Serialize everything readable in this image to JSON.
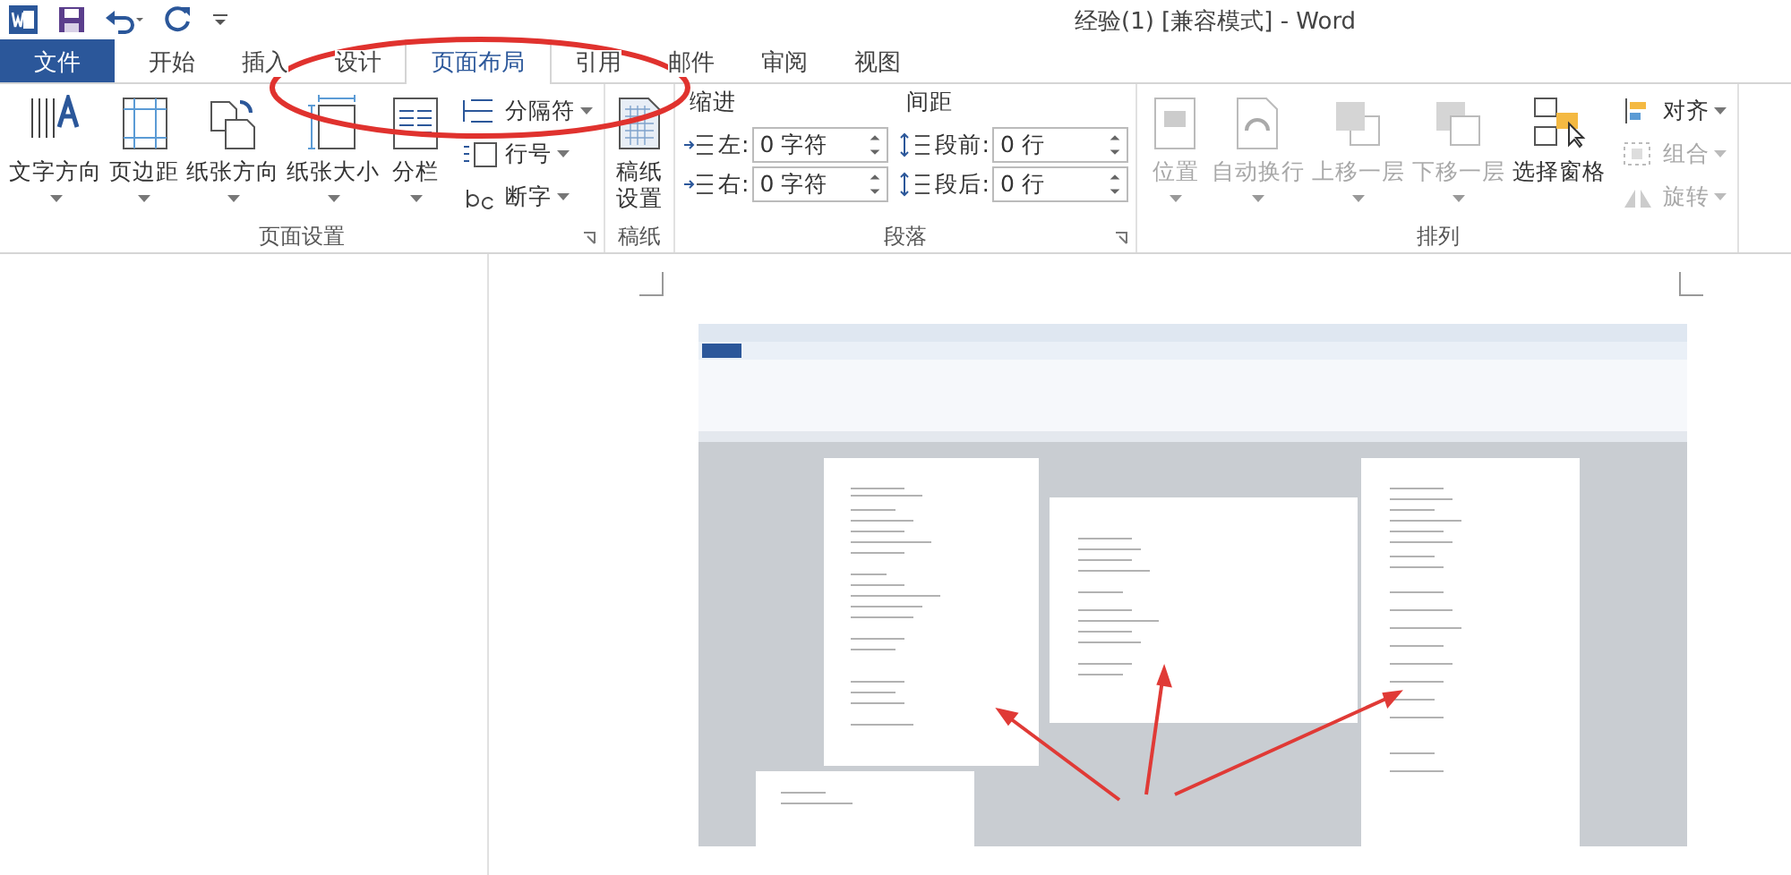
{
  "window": {
    "title": "经验(1) [兼容模式] - Word"
  },
  "tabs": [
    {
      "label": "文件",
      "kind": "file",
      "selected": false
    },
    {
      "label": "开始",
      "kind": "tab",
      "selected": false
    },
    {
      "label": "插入",
      "kind": "tab",
      "selected": false
    },
    {
      "label": "设计",
      "kind": "tab",
      "selected": false
    },
    {
      "label": "页面布局",
      "kind": "tab",
      "selected": true
    },
    {
      "label": "引用",
      "kind": "tab",
      "selected": false
    },
    {
      "label": "邮件",
      "kind": "tab",
      "selected": false
    },
    {
      "label": "审阅",
      "kind": "tab",
      "selected": false
    },
    {
      "label": "视图",
      "kind": "tab",
      "selected": false
    }
  ],
  "page_setup": {
    "label": "页面设置",
    "large": [
      {
        "label": "文字方向"
      },
      {
        "label": "页边距"
      },
      {
        "label": "纸张方向"
      },
      {
        "label": "纸张大小"
      },
      {
        "label": "分栏"
      }
    ],
    "small": [
      {
        "label": "分隔符"
      },
      {
        "label": "行号"
      },
      {
        "label": "断字"
      }
    ]
  },
  "manuscript": {
    "label": "稿纸",
    "button": "稿纸设置"
  },
  "paragraph": {
    "label": "段落",
    "indent_label": "缩进",
    "spacing_label": "间距",
    "indent": [
      {
        "label": "左:",
        "value": "0 字符"
      },
      {
        "label": "右:",
        "value": "0 字符"
      }
    ],
    "spacing": [
      {
        "label": "段前:",
        "value": "0 行"
      },
      {
        "label": "段后:",
        "value": "0 行"
      }
    ]
  },
  "arrange": {
    "label": "排列",
    "large": [
      {
        "label": "位置",
        "disabled": true
      },
      {
        "label": "自动换行",
        "disabled": true
      },
      {
        "label": "上移一层",
        "disabled": true
      },
      {
        "label": "下移一层",
        "disabled": true
      },
      {
        "label": "选择窗格",
        "disabled": false
      }
    ],
    "small": [
      {
        "label": "对齐",
        "disabled": false
      },
      {
        "label": "组合",
        "disabled": true
      },
      {
        "label": "旋转",
        "disabled": true
      }
    ]
  }
}
